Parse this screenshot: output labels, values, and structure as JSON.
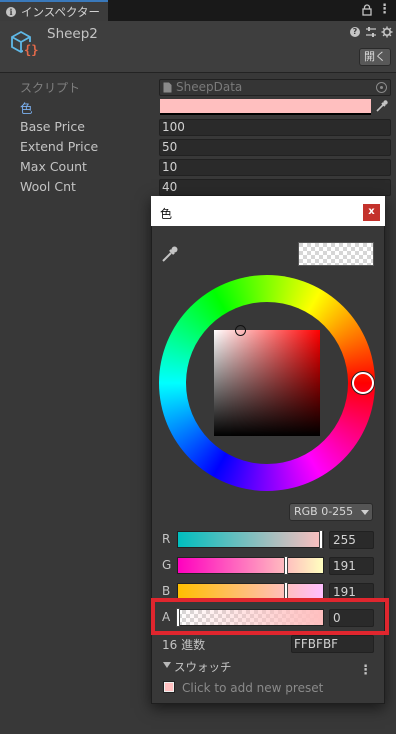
{
  "tab": {
    "title": "インスペクター",
    "info_icon": "info-icon"
  },
  "header": {
    "object_name": "Sheep2",
    "open_button": "開く"
  },
  "properties": {
    "script_label": "スクリプト",
    "script_value": "SheepData",
    "color_label": "色",
    "color_value": "#ffbfbf",
    "rows": [
      {
        "label": "Base Price",
        "value": "100"
      },
      {
        "label": "Extend Price",
        "value": "50"
      },
      {
        "label": "Max Count",
        "value": "10"
      },
      {
        "label": "Wool Cnt",
        "value": "40"
      }
    ]
  },
  "picker": {
    "title": "色",
    "close": "x",
    "mode": "RGB 0-255",
    "channels": {
      "r": {
        "label": "R",
        "value": "255"
      },
      "g": {
        "label": "G",
        "value": "191"
      },
      "b": {
        "label": "B",
        "value": "191"
      },
      "a": {
        "label": "A",
        "value": "0"
      }
    },
    "hex_label": "16 進数",
    "hex_value": "FFBFBF",
    "swatches_label": "スウォッチ",
    "preset_hint": "Click to add new preset"
  },
  "colors": {
    "current_color": "#ffbfbf",
    "highlight": "#e0262e",
    "accent": "#3a79bb",
    "close_button": "#c4322c"
  }
}
